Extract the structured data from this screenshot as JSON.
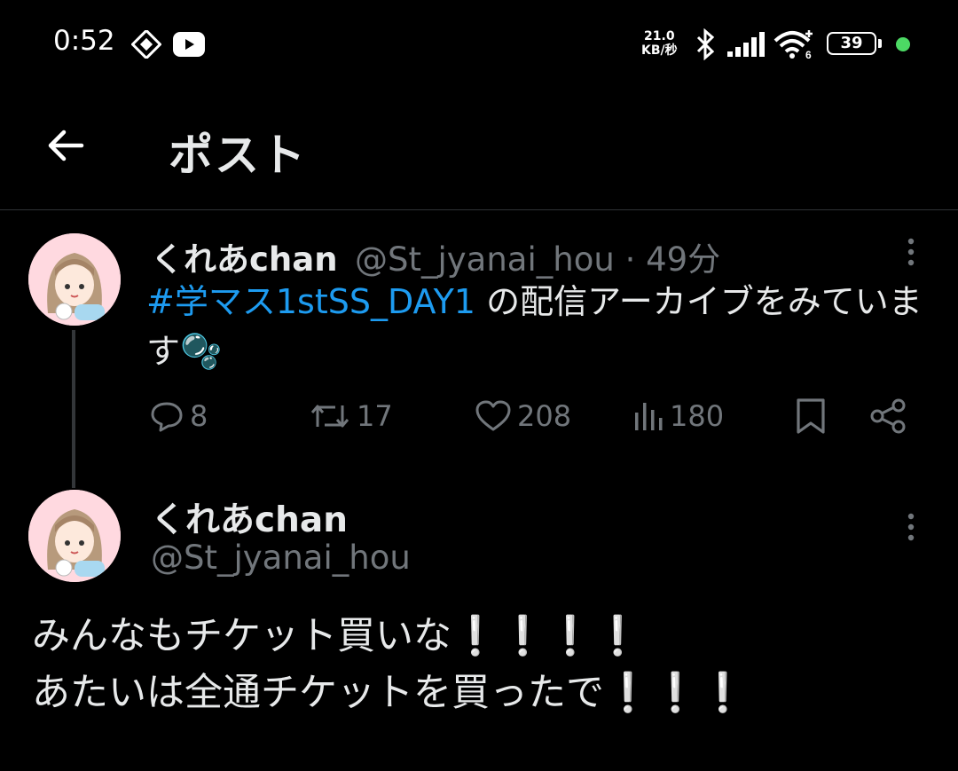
{
  "status_bar": {
    "time": "0:52",
    "net_speed_value": "21.0",
    "net_speed_unit": "KB/秒",
    "battery": "39",
    "wifi_sub": "6"
  },
  "header": {
    "title": "ポスト"
  },
  "post1": {
    "display_name": "くれあchan",
    "handle": "@St_jyanai_hou",
    "separator": "·",
    "time_ago": "49分",
    "hashtag": "#学マス1stSS_DAY1",
    "text": " の配信アーカイブをみています",
    "emoji": "🫧",
    "replies": "8",
    "reposts": "17",
    "likes": "208",
    "views": "180"
  },
  "post2": {
    "display_name": "くれあchan",
    "handle": "@St_jyanai_hou",
    "text": "みんなもチケット買いな❕❕❕❕\nあたいは全通チケットを買ったで❕❕❕"
  },
  "colors": {
    "background": "#000000",
    "text": "#e7e9ea",
    "muted": "#71767b",
    "link": "#1d9bf0",
    "divider": "#2f3336"
  }
}
